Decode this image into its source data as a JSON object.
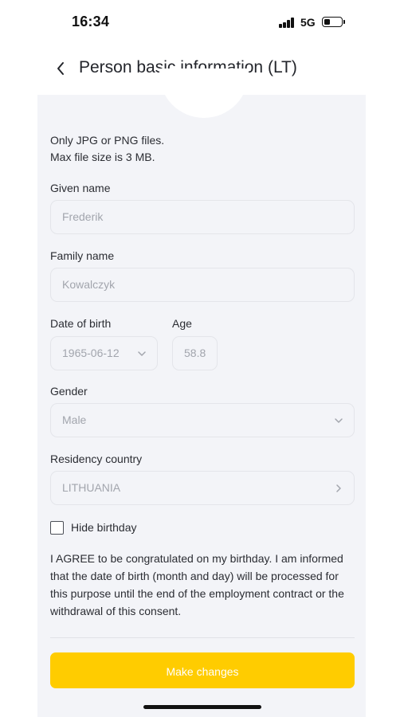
{
  "status_bar": {
    "time": "16:34",
    "network": "5G"
  },
  "header": {
    "title": "Person basic information (LT)"
  },
  "photo": {
    "hint_line1": "Only JPG or PNG files.",
    "hint_line2": "Max file size is 3 MB."
  },
  "form": {
    "given_name": {
      "label": "Given name",
      "value": "Frederik"
    },
    "family_name": {
      "label": "Family name",
      "value": "Kowalczyk"
    },
    "date_of_birth": {
      "label": "Date of birth",
      "value": "1965-06-12"
    },
    "age": {
      "label": "Age",
      "value": "58.8"
    },
    "gender": {
      "label": "Gender",
      "value": "Male"
    },
    "residency_country": {
      "label": "Residency country",
      "value": "LITHUANIA"
    },
    "hide_birthday": {
      "label": "Hide birthday",
      "checked": false
    },
    "consent_text": "I AGREE to be congratulated on my birthday. I am informed that the date of birth (month and day) will be processed for this purpose until the end of the employment contract or the withdrawal of this consent."
  },
  "actions": {
    "make_changes_label": "Make changes"
  },
  "colors": {
    "accent": "#ffcc00",
    "card_bg": "#f3f4f8",
    "placeholder_text": "#a2a5ad"
  }
}
